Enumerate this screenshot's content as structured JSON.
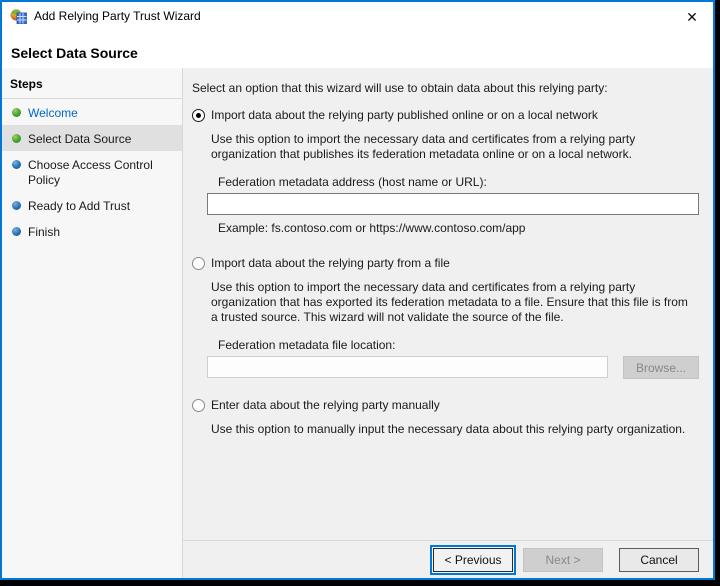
{
  "window": {
    "title": "Add Relying Party Trust Wizard",
    "close_glyph": "✕"
  },
  "header": {
    "title": "Select Data Source"
  },
  "sidebar": {
    "title": "Steps",
    "items": [
      {
        "label": "Welcome",
        "state": "visited",
        "bullet": "green"
      },
      {
        "label": "Select Data Source",
        "state": "current",
        "bullet": "green"
      },
      {
        "label": "Choose Access Control Policy",
        "state": "upcoming",
        "bullet": "blue"
      },
      {
        "label": "Ready to Add Trust",
        "state": "upcoming",
        "bullet": "blue"
      },
      {
        "label": "Finish",
        "state": "upcoming",
        "bullet": "blue"
      }
    ]
  },
  "content": {
    "intro": "Select an option that this wizard will use to obtain data about this relying party:",
    "options": [
      {
        "label": "Import data about the relying party published online or on a local network",
        "selected": true,
        "description": "Use this option to import the necessary data and certificates from a relying party organization that publishes its federation metadata online or on a local network.",
        "field_label": "Federation metadata address (host name or URL):",
        "field_value": "",
        "example": "Example: fs.contoso.com or https://www.contoso.com/app"
      },
      {
        "label": "Import data about the relying party from a file",
        "selected": false,
        "description": "Use this option to import the necessary data and certificates from a relying party organization that has exported its federation metadata to a file. Ensure that this file is from a trusted source.  This wizard will not validate the source of the file.",
        "field_label": "Federation metadata file location:",
        "field_value": "",
        "browse_label": "Browse..."
      },
      {
        "label": "Enter data about the relying party manually",
        "selected": false,
        "description": "Use this option to manually input the necessary data about this relying party organization."
      }
    ]
  },
  "footer": {
    "previous_label": "< Previous",
    "next_label": "Next >",
    "cancel_label": "Cancel"
  },
  "colors": {
    "accent_blue": "#0078d7",
    "link_blue": "#0066cc",
    "visited_bullet_green": "#44a12b",
    "upcoming_bullet_blue": "#2570b4",
    "selected_step_bg": "#e0e0e0",
    "content_bg": "#f0f0f0"
  }
}
